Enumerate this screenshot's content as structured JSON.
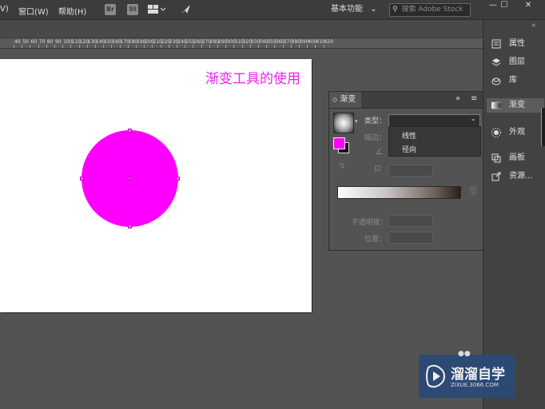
{
  "menubar": {
    "items": [
      "V)",
      "窗口(W)",
      "帮助(H)"
    ],
    "icons": [
      "Br",
      "St"
    ],
    "workspace": "基本功能",
    "search_placeholder": "搜索 Adobe Stock",
    "window_buttons": [
      "—",
      "☐",
      "✕"
    ]
  },
  "ruler": {
    "numbers": [
      "40",
      "50",
      "60",
      "70",
      "80",
      "90",
      "100",
      "110",
      "120",
      "130",
      "140",
      "150",
      "160",
      "170",
      "180",
      "190",
      "200",
      "210",
      "220",
      "230",
      "240",
      "250",
      "260",
      "270",
      "280",
      "290",
      "300",
      "310",
      "320",
      "330",
      "340",
      "350",
      "360",
      "370",
      "380",
      "390",
      "400",
      "410",
      "420"
    ]
  },
  "artboard": {
    "title": "渐变工具的使用",
    "circle_color": "#ff00ff"
  },
  "gradient_panel": {
    "tab_label": "渐变",
    "collapse_icon": "»",
    "menu_icon": "≡",
    "type_label": "类型：",
    "stroke_label": "描边：",
    "type_options": [
      "线性",
      "径向"
    ],
    "opacity_label": "不透明度：",
    "position_label": "位置：",
    "fill_color": "#ff00ff",
    "trash_icon": "trash-icon"
  },
  "dock": {
    "items": [
      "属性",
      "图层",
      "库",
      "渐变",
      "外观",
      "画板",
      "资源..."
    ],
    "active": "渐变"
  },
  "watermark": {
    "name": "溜溜自学",
    "url": "ZIXUE.3066.COM"
  }
}
